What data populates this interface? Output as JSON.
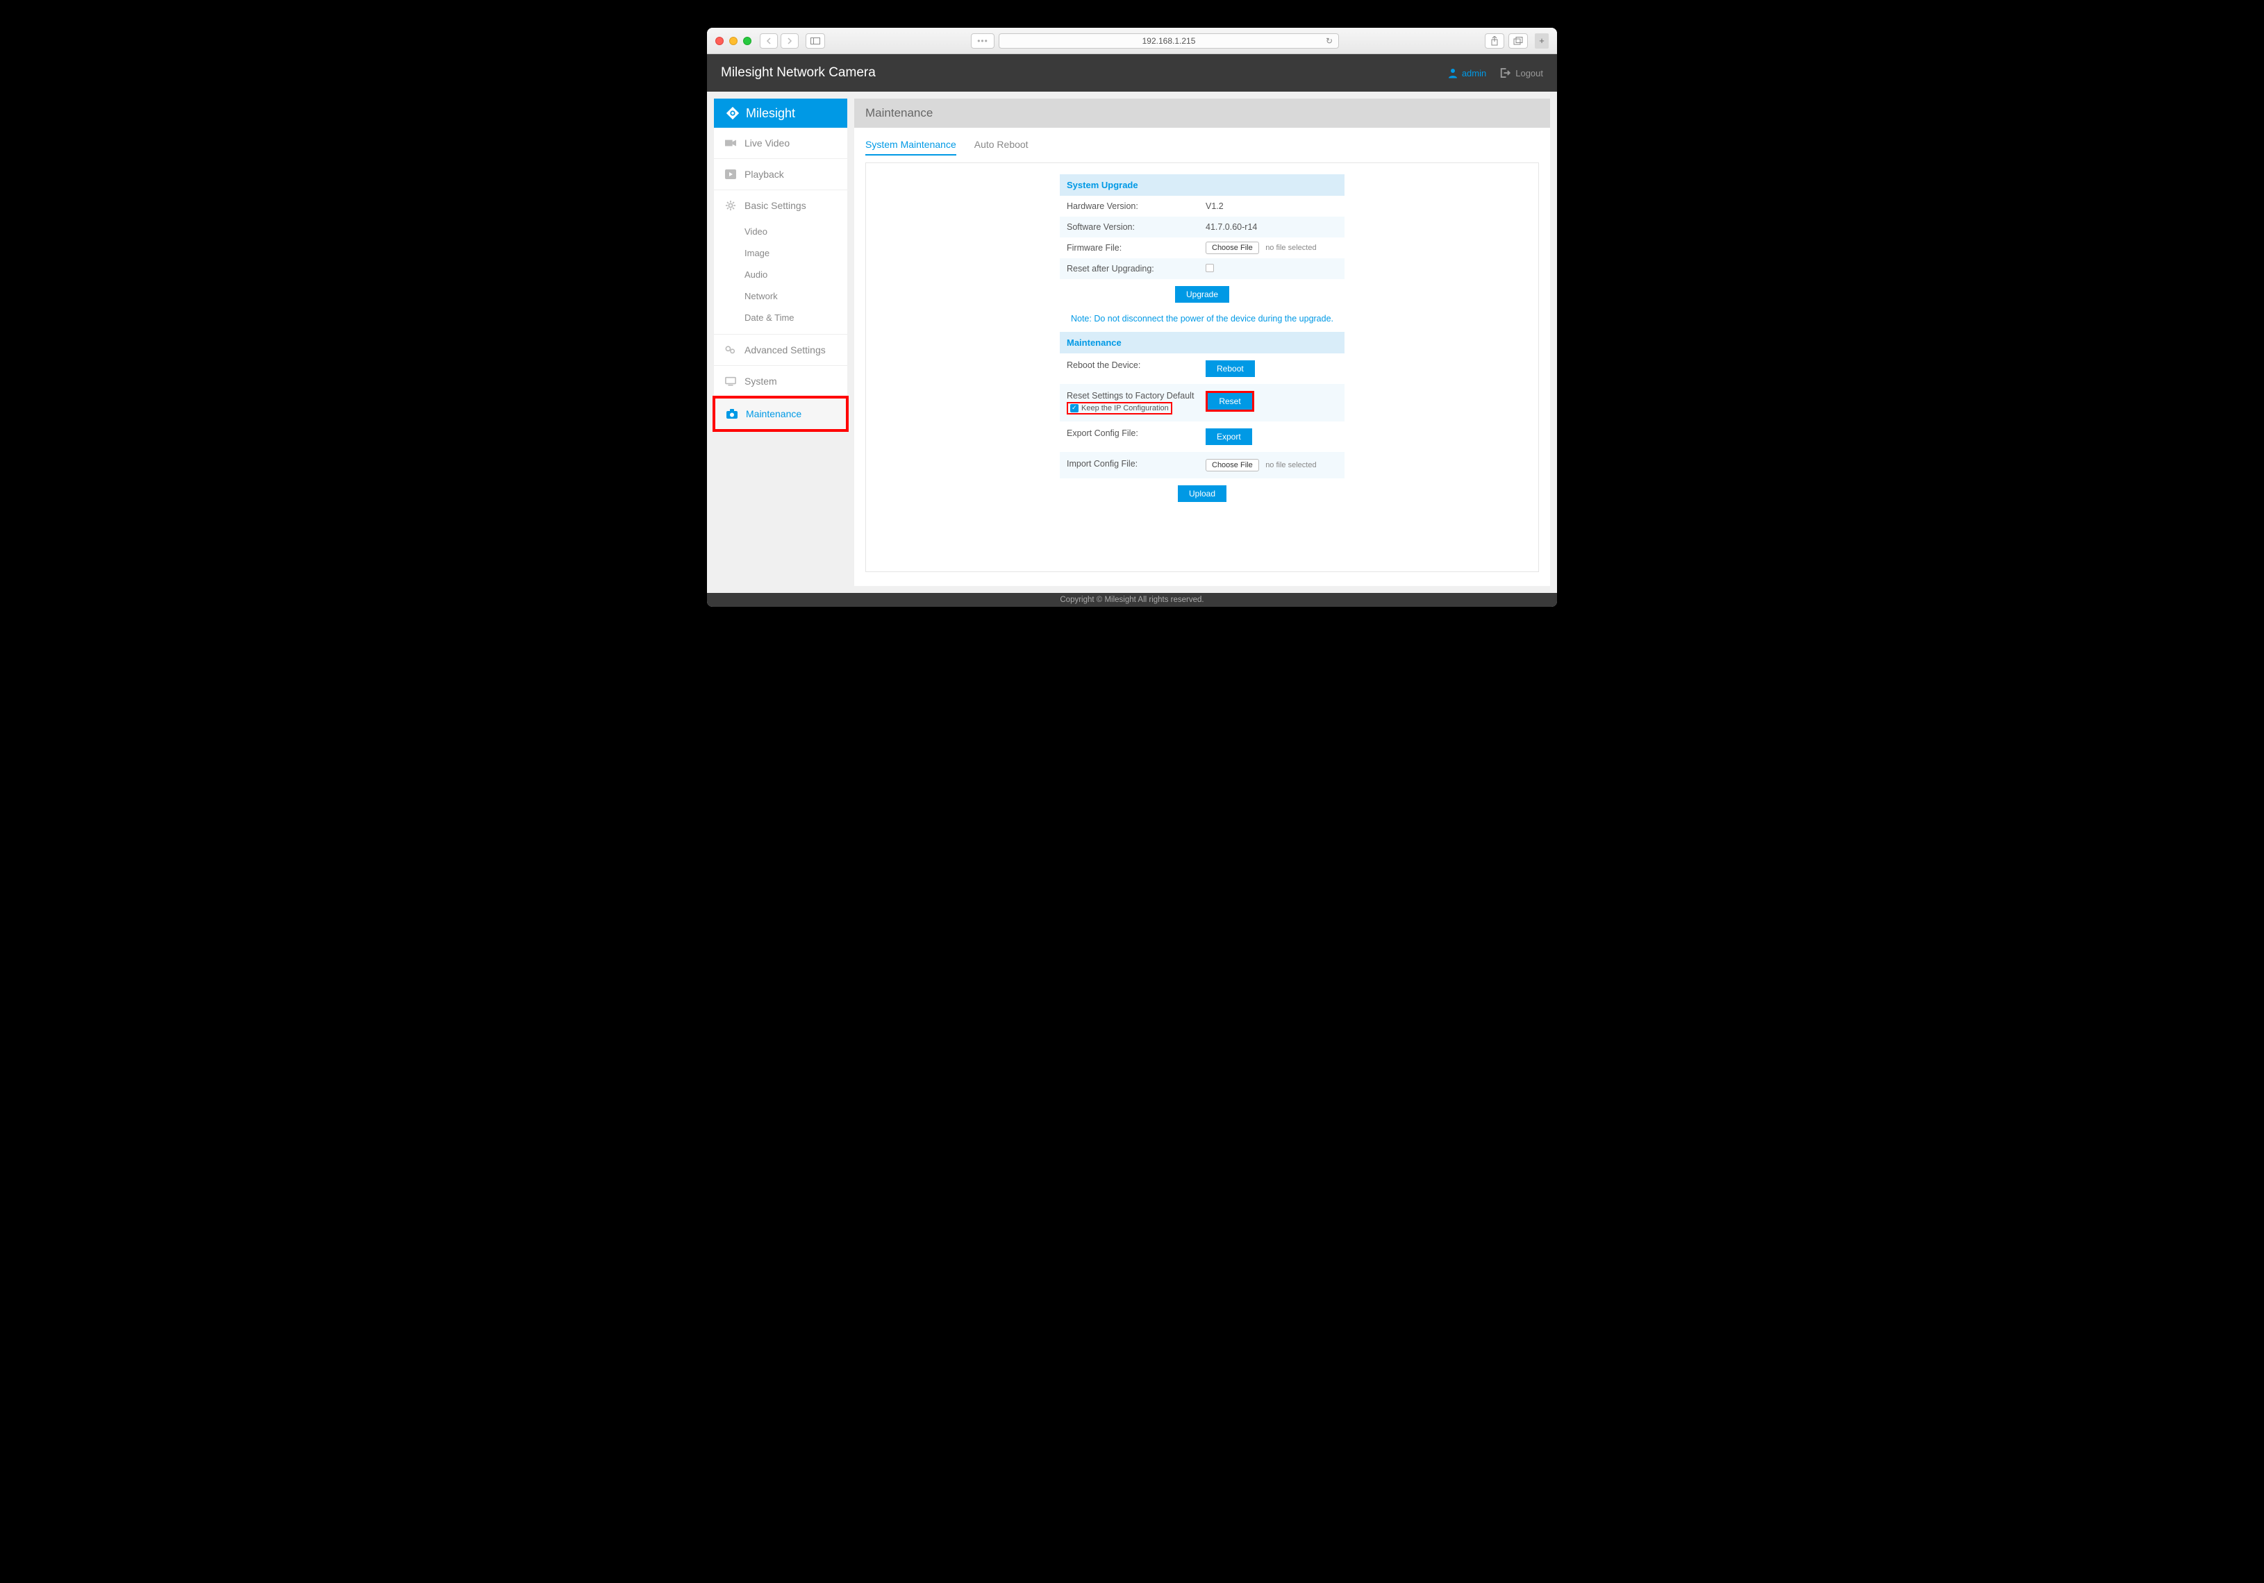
{
  "browser": {
    "url": "192.168.1.215"
  },
  "header": {
    "title": "Milesight Network Camera",
    "user": "admin",
    "logout": "Logout"
  },
  "sidebar": {
    "brand": "Milesight",
    "live_video": "Live Video",
    "playback": "Playback",
    "basic_settings": "Basic Settings",
    "sub_video": "Video",
    "sub_image": "Image",
    "sub_audio": "Audio",
    "sub_network": "Network",
    "sub_datetime": "Date & Time",
    "advanced_settings": "Advanced Settings",
    "system": "System",
    "maintenance": "Maintenance"
  },
  "page": {
    "title": "Maintenance",
    "tabs": {
      "sys": "System Maintenance",
      "auto": "Auto Reboot"
    }
  },
  "upgrade": {
    "head": "System Upgrade",
    "hw_label": "Hardware Version:",
    "hw_value": "V1.2",
    "sw_label": "Software Version:",
    "sw_value": "41.7.0.60-r14",
    "fw_label": "Firmware File:",
    "choose_file": "Choose File",
    "no_file": "no file selected",
    "reset_after_label": "Reset after Upgrading:",
    "upgrade_btn": "Upgrade",
    "note": "Note: Do not disconnect the power of the device during the upgrade."
  },
  "maint": {
    "head": "Maintenance",
    "reboot_label": "Reboot the Device:",
    "reboot_btn": "Reboot",
    "reset_label": "Reset Settings to Factory Default",
    "keep_ip": "Keep the IP Configuration",
    "reset_btn": "Reset",
    "export_label": "Export Config File:",
    "export_btn": "Export",
    "import_label": "Import Config File:",
    "upload_btn": "Upload"
  },
  "footer": "Copyright © Milesight All rights reserved."
}
